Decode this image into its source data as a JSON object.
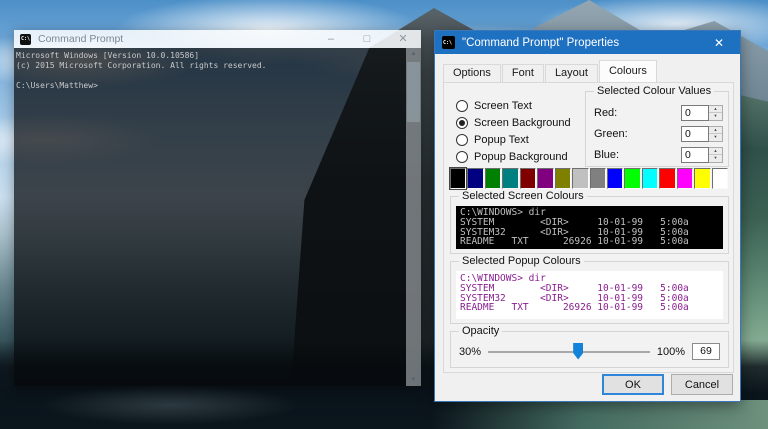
{
  "colors": {
    "dialog_titlebar": "#1e70c1",
    "accent_slider": "#1283d8",
    "screen_preview_text": "#c0c0c0",
    "screen_preview_background": "#000000",
    "popup_preview_text": "#8a2090",
    "popup_preview_background": "#ffffff"
  },
  "cmd_window": {
    "icon_text": "C:\\",
    "title": "Command Prompt",
    "controls": {
      "minimize": "–",
      "maximize": "□",
      "close": "✕"
    },
    "scrollbar": {
      "up": "▲",
      "down": "▼"
    },
    "console_lines": [
      "Microsoft Windows [Version 10.0.10586]",
      "(c) 2015 Microsoft Corporation. All rights reserved.",
      "",
      "C:\\Users\\Matthew>"
    ]
  },
  "dialog": {
    "icon_text": "C:\\",
    "title": "\"Command Prompt\" Properties",
    "close_glyph": "✕",
    "tabs": [
      {
        "label": "Options",
        "active": false
      },
      {
        "label": "Font",
        "active": false
      },
      {
        "label": "Layout",
        "active": false
      },
      {
        "label": "Colours",
        "active": true
      }
    ],
    "radio_group": [
      {
        "label": "Screen Text",
        "selected": false
      },
      {
        "label": "Screen Background",
        "selected": true
      },
      {
        "label": "Popup Text",
        "selected": false
      },
      {
        "label": "Popup Background",
        "selected": false
      }
    ],
    "colour_values": {
      "legend": "Selected Colour Values",
      "spinner_up": "▲",
      "spinner_down": "▼",
      "fields": [
        {
          "label": "Red:",
          "value": "0"
        },
        {
          "label": "Green:",
          "value": "0"
        },
        {
          "label": "Blue:",
          "value": "0"
        }
      ]
    },
    "palette": [
      {
        "hex": "#000000",
        "selected": true
      },
      {
        "hex": "#000080"
      },
      {
        "hex": "#008000"
      },
      {
        "hex": "#008080"
      },
      {
        "hex": "#800000"
      },
      {
        "hex": "#800080"
      },
      {
        "hex": "#808000"
      },
      {
        "hex": "#c0c0c0"
      },
      {
        "hex": "#808080"
      },
      {
        "hex": "#0000ff"
      },
      {
        "hex": "#00ff00"
      },
      {
        "hex": "#00ffff"
      },
      {
        "hex": "#ff0000"
      },
      {
        "hex": "#ff00ff"
      },
      {
        "hex": "#ffff00"
      },
      {
        "hex": "#ffffff"
      }
    ],
    "screen_preview": {
      "legend": "Selected Screen Colours",
      "lines": [
        "C:\\WINDOWS> dir",
        "SYSTEM        <DIR>     10-01-99   5:00a",
        "SYSTEM32      <DIR>     10-01-99   5:00a",
        "README   TXT      26926 10-01-99   5:00a"
      ]
    },
    "popup_preview": {
      "legend": "Selected Popup Colours",
      "lines": [
        "C:\\WINDOWS> dir",
        "SYSTEM        <DIR>     10-01-99   5:00a",
        "SYSTEM32      <DIR>     10-01-99   5:00a",
        "README   TXT      26926 10-01-99   5:00a"
      ]
    },
    "opacity": {
      "legend": "Opacity",
      "min_label": "30%",
      "max_label": "100%",
      "min": 30,
      "max": 100,
      "value": 69
    },
    "buttons": {
      "ok": "OK",
      "cancel": "Cancel"
    }
  }
}
